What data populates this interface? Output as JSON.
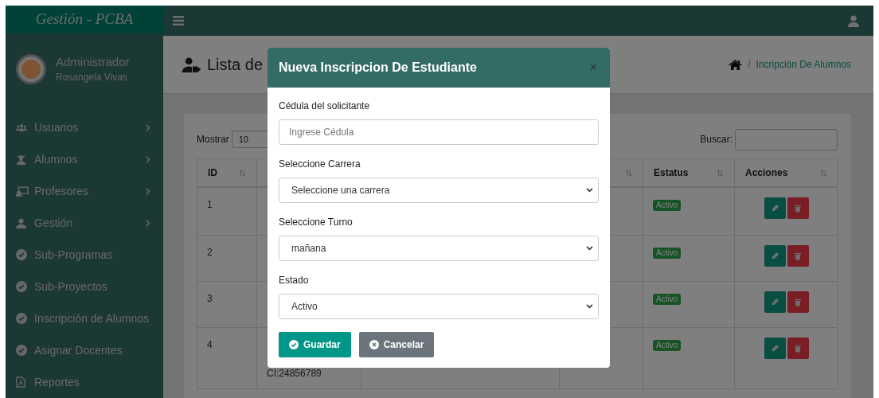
{
  "brand": "Gestión - PCBA",
  "user": {
    "role": "Administrador",
    "name": "Rosangela Vivas"
  },
  "sidebar": {
    "items": [
      {
        "label": "Usuarios",
        "expandable": true
      },
      {
        "label": "Alumnos",
        "expandable": true
      },
      {
        "label": "Profesores",
        "expandable": true
      },
      {
        "label": "Gestión",
        "expandable": true
      },
      {
        "label": "Sub-Programas",
        "expandable": false
      },
      {
        "label": "Sub-Proyectos",
        "expandable": false
      },
      {
        "label": "Inscripción de Alumnos",
        "expandable": false
      },
      {
        "label": "Asignar Docentes",
        "expandable": false
      },
      {
        "label": "Reportes",
        "expandable": false
      }
    ]
  },
  "page": {
    "title": "Lista de",
    "breadcrumb": {
      "separator": "/",
      "current": "Incripción De Alumnos"
    }
  },
  "table_controls": {
    "show_label": "Mostrar",
    "page_size": "10",
    "search_label": "Buscar:"
  },
  "table": {
    "columns": [
      {
        "label": "ID",
        "sortable": true
      },
      {},
      {},
      {
        "sortable": true
      },
      {
        "label": "Estatus",
        "sortable": true
      },
      {
        "label": "Acciones",
        "sortable": true
      }
    ],
    "rows": [
      {
        "id": "1",
        "status": "Activo"
      },
      {
        "id": "2",
        "status": "Activo"
      },
      {
        "id": "3",
        "status": "Activo"
      },
      {
        "id": "4",
        "column_2": "CI:24856789",
        "status": "Activo"
      }
    ]
  },
  "modal": {
    "title": "Nueva Inscripcion De Estudiante",
    "close": "×",
    "fields": [
      {
        "kind": "input",
        "label": "Cédula del solicitante",
        "placeholder": "Ingrese Cédula"
      },
      {
        "kind": "select",
        "label": "Seleccione Carrera",
        "value": "Seleccione una carrera"
      },
      {
        "kind": "select",
        "label": "Seleccione Turno",
        "value": "mañana"
      },
      {
        "kind": "select",
        "label": "Estado",
        "value": "Activo"
      }
    ],
    "buttons": [
      {
        "kind": "primary",
        "label": "Guardar"
      },
      {
        "kind": "secondary",
        "label": "Cancelar"
      }
    ]
  }
}
